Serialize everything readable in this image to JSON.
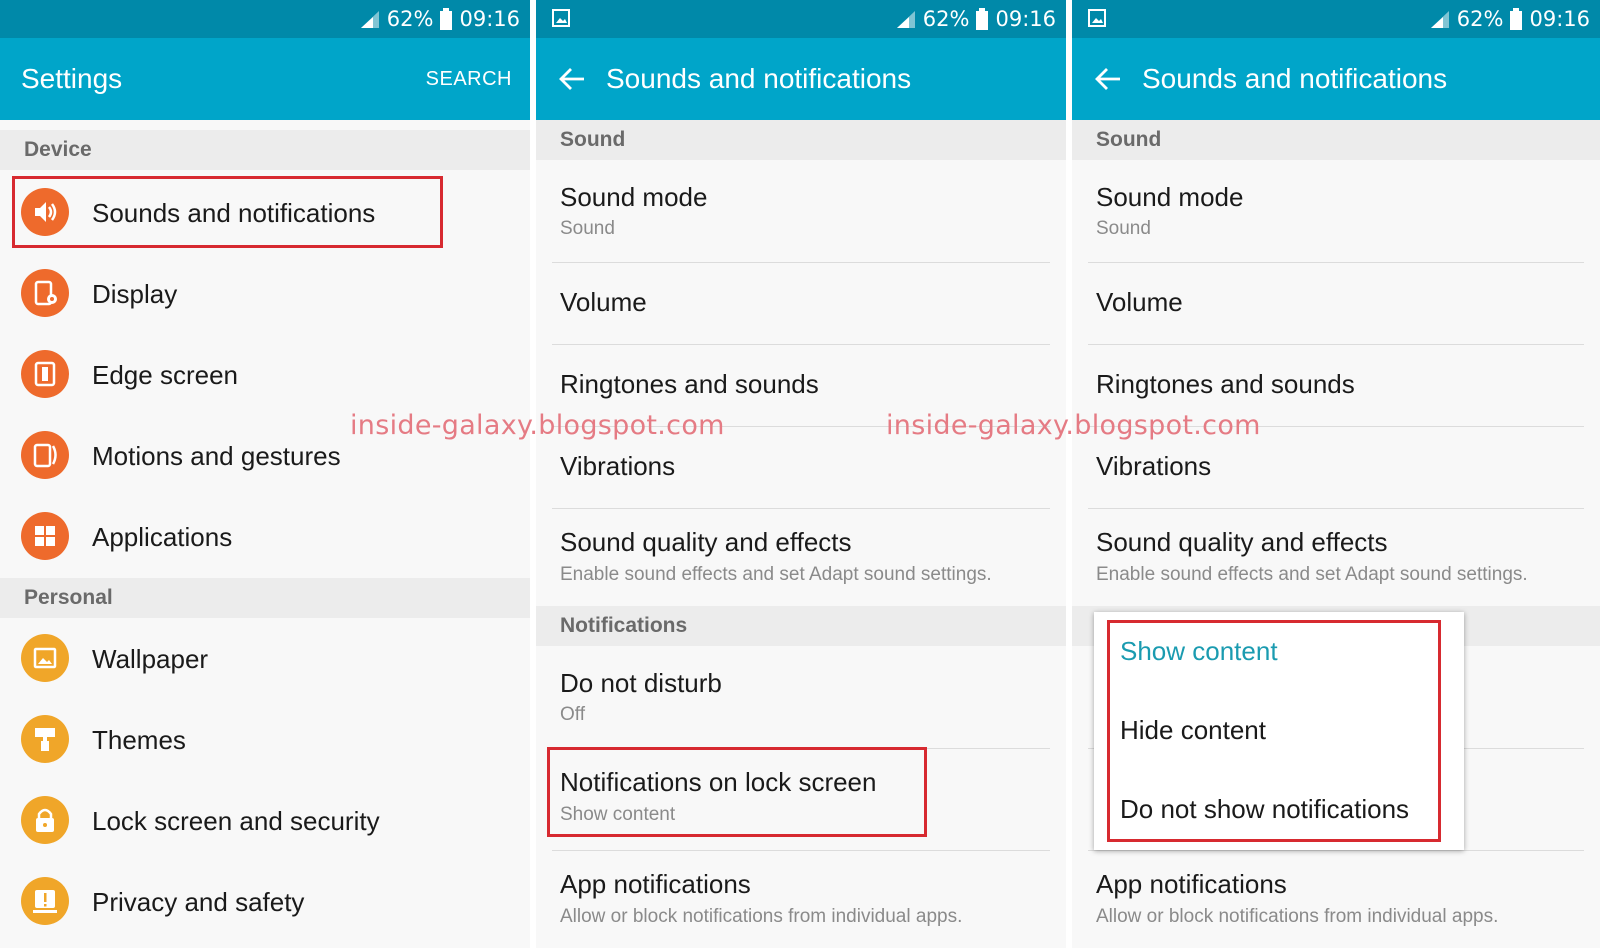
{
  "status_bar": {
    "battery": "62%",
    "time": "09:16"
  },
  "settings": {
    "title": "Settings",
    "search_label": "SEARCH",
    "sections": [
      {
        "header": "Device",
        "items": [
          {
            "label": "Sounds and notifications",
            "icon": "speaker-icon",
            "color": "#ee6a2c"
          },
          {
            "label": "Display",
            "icon": "display-settings-icon",
            "color": "#ee6a2c"
          },
          {
            "label": "Edge screen",
            "icon": "edge-screen-icon",
            "color": "#ee6a2c"
          },
          {
            "label": "Motions and gestures",
            "icon": "motion-gesture-icon",
            "color": "#ee6a2c"
          },
          {
            "label": "Applications",
            "icon": "applications-grid-icon",
            "color": "#ee6a2c"
          }
        ]
      },
      {
        "header": "Personal",
        "items": [
          {
            "label": "Wallpaper",
            "icon": "wallpaper-icon",
            "color": "#f0a629"
          },
          {
            "label": "Themes",
            "icon": "paint-roller-icon",
            "color": "#f0a629"
          },
          {
            "label": "Lock screen and security",
            "icon": "lock-icon",
            "color": "#f0a629"
          },
          {
            "label": "Privacy and safety",
            "icon": "privacy-alert-icon",
            "color": "#f0a629"
          }
        ]
      }
    ]
  },
  "sounds_page": {
    "title": "Sounds and notifications",
    "sound_header": "Sound",
    "sound_mode": {
      "title": "Sound mode",
      "value": "Sound"
    },
    "volume": "Volume",
    "ringtones": "Ringtones and sounds",
    "vibrations": "Vibrations",
    "sound_quality": {
      "title": "Sound quality and effects",
      "subtitle": "Enable sound effects and set Adapt sound settings."
    },
    "notifications_header": "Notifications",
    "do_not_disturb": {
      "title": "Do not disturb",
      "value": "Off"
    },
    "lock_screen_notifications": {
      "title": "Notifications on lock screen",
      "value": "Show content"
    },
    "app_notifications": {
      "title": "App notifications",
      "subtitle": "Allow or block notifications from individual apps."
    }
  },
  "lock_screen_popup": {
    "options": [
      "Show content",
      "Hide content",
      "Do not show notifications"
    ],
    "selected_color": "#1a9bb0"
  },
  "watermark": "inside-galaxy.blogspot.com",
  "colors": {
    "status_bar": "#0089a9",
    "app_bar": "#00a5c9",
    "highlight_border": "#d72a30",
    "device_icon": "#ee6a2c",
    "personal_icon": "#f0a629"
  }
}
